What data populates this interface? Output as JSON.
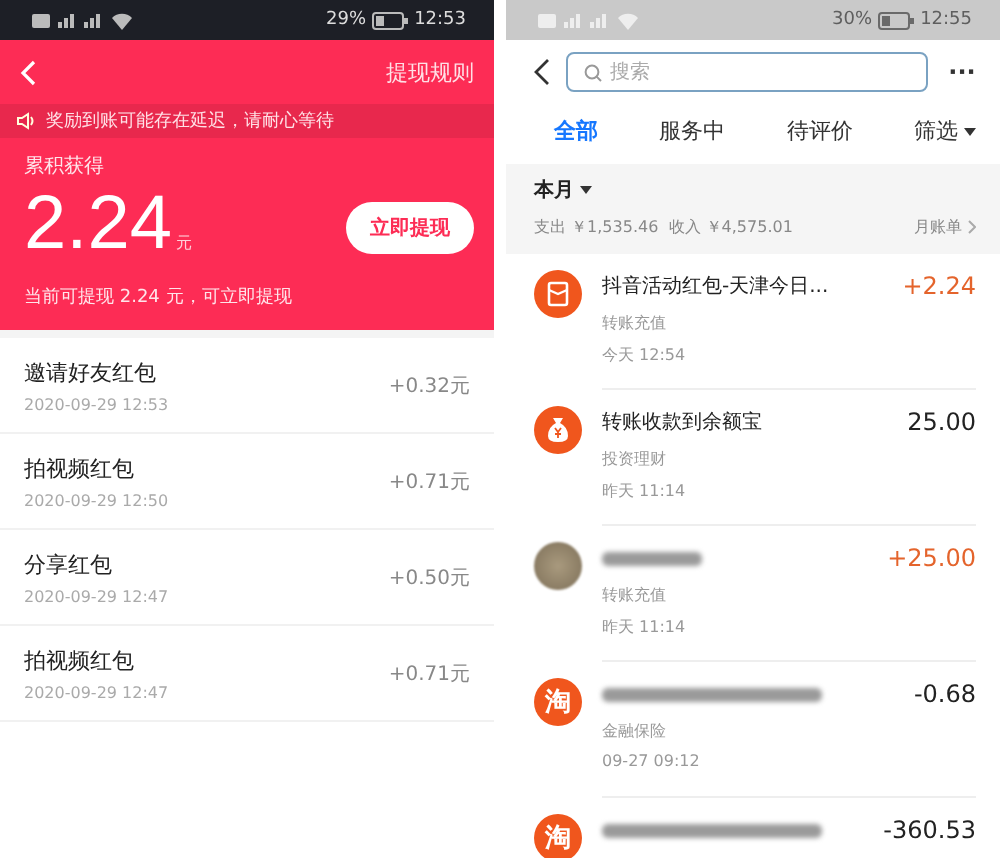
{
  "left": {
    "status_bar": {
      "battery": "29%",
      "time": "12:53"
    },
    "header": {
      "rules_link": "提现规则"
    },
    "notice": "奖励到账可能存在延迟，请耐心等待",
    "summary": {
      "label": "累积获得",
      "amount": "2.24",
      "unit": "元",
      "button": "立即提现",
      "note": "当前可提现 2.24 元，可立即提现"
    },
    "records": [
      {
        "title": "邀请好友红包",
        "time": "2020-09-29 12:53",
        "amount": "+0.32元"
      },
      {
        "title": "拍视频红包",
        "time": "2020-09-29 12:50",
        "amount": "+0.71元"
      },
      {
        "title": "分享红包",
        "time": "2020-09-29 12:47",
        "amount": "+0.50元"
      },
      {
        "title": "拍视频红包",
        "time": "2020-09-29 12:47",
        "amount": "+0.71元"
      }
    ]
  },
  "right": {
    "status_bar": {
      "battery": "30%",
      "time": "12:55"
    },
    "search": {
      "placeholder": "搜索"
    },
    "more": "···",
    "tabs": [
      {
        "label": "全部",
        "selected": true
      },
      {
        "label": "服务中",
        "selected": false
      },
      {
        "label": "待评价",
        "selected": false
      }
    ],
    "filter": "筛选",
    "month": {
      "label": "本月",
      "summary": "支出 ￥1,535.46  收入 ￥4,575.01",
      "bill_link": "月账单"
    },
    "bills": [
      {
        "kind": "envelope",
        "title": "抖音活动红包-天津今日...",
        "redacted": false,
        "category": "转账充值",
        "time": "今天 12:54",
        "amount": "+2.24",
        "income": true
      },
      {
        "kind": "money-bag",
        "title": "转账收款到余额宝",
        "redacted": false,
        "category": "投资理财",
        "time": "昨天 11:14",
        "amount": "25.00",
        "income": false
      },
      {
        "kind": "avatar",
        "redacted": true,
        "category": "转账充值",
        "time": "昨天 11:14",
        "amount": "+25.00",
        "income": true
      },
      {
        "kind": "shop",
        "glyph": "淘",
        "redacted": true,
        "category": "金融保险",
        "time": "09-27  09:12",
        "amount": "-0.68",
        "income": false
      },
      {
        "kind": "shop",
        "glyph": "淘",
        "redacted": true,
        "amount": "-360.53",
        "income": false
      }
    ]
  }
}
